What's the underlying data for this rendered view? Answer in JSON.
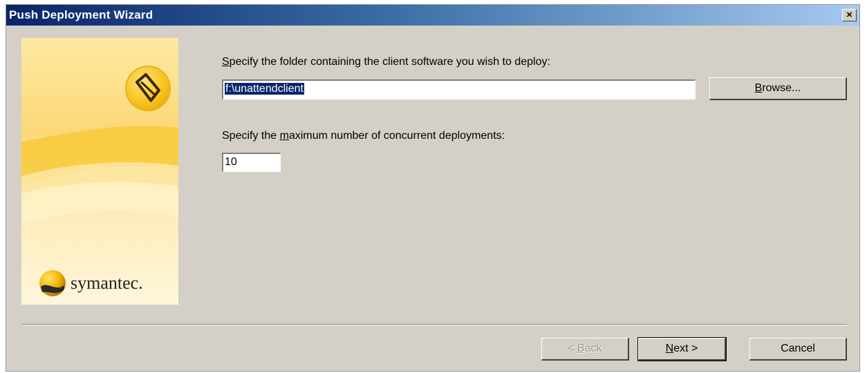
{
  "window": {
    "title": "Push Deployment Wizard",
    "close_glyph": "×"
  },
  "side_panel": {
    "brand_text": "symantec.",
    "badge_icon": "symantec-product-badge-icon",
    "logo_icon": "symantec-sphere-logo-icon"
  },
  "folder": {
    "label_prefix": "",
    "label_mnemonic": "S",
    "label_rest": "pecify the folder containing the client software you wish to deploy:",
    "value": "f:\\unattendclient",
    "browse_mnemonic": "B",
    "browse_rest": "rowse..."
  },
  "concurrency": {
    "label_prefix": "Specify the ",
    "label_mnemonic": "m",
    "label_rest": "aximum number of concurrent deployments:",
    "value": "10"
  },
  "footer": {
    "back_prefix": "< ",
    "back_mnemonic": "B",
    "back_rest": "ack",
    "next_mnemonic": "N",
    "next_rest": "ext >",
    "cancel_label": "Cancel"
  },
  "colors": {
    "titlebar_start": "#0a246a",
    "titlebar_end": "#a6caf0",
    "dialog_bg": "#d4d0c8",
    "selection": "#0a246a",
    "accent_yellow": "#f6c21a"
  }
}
